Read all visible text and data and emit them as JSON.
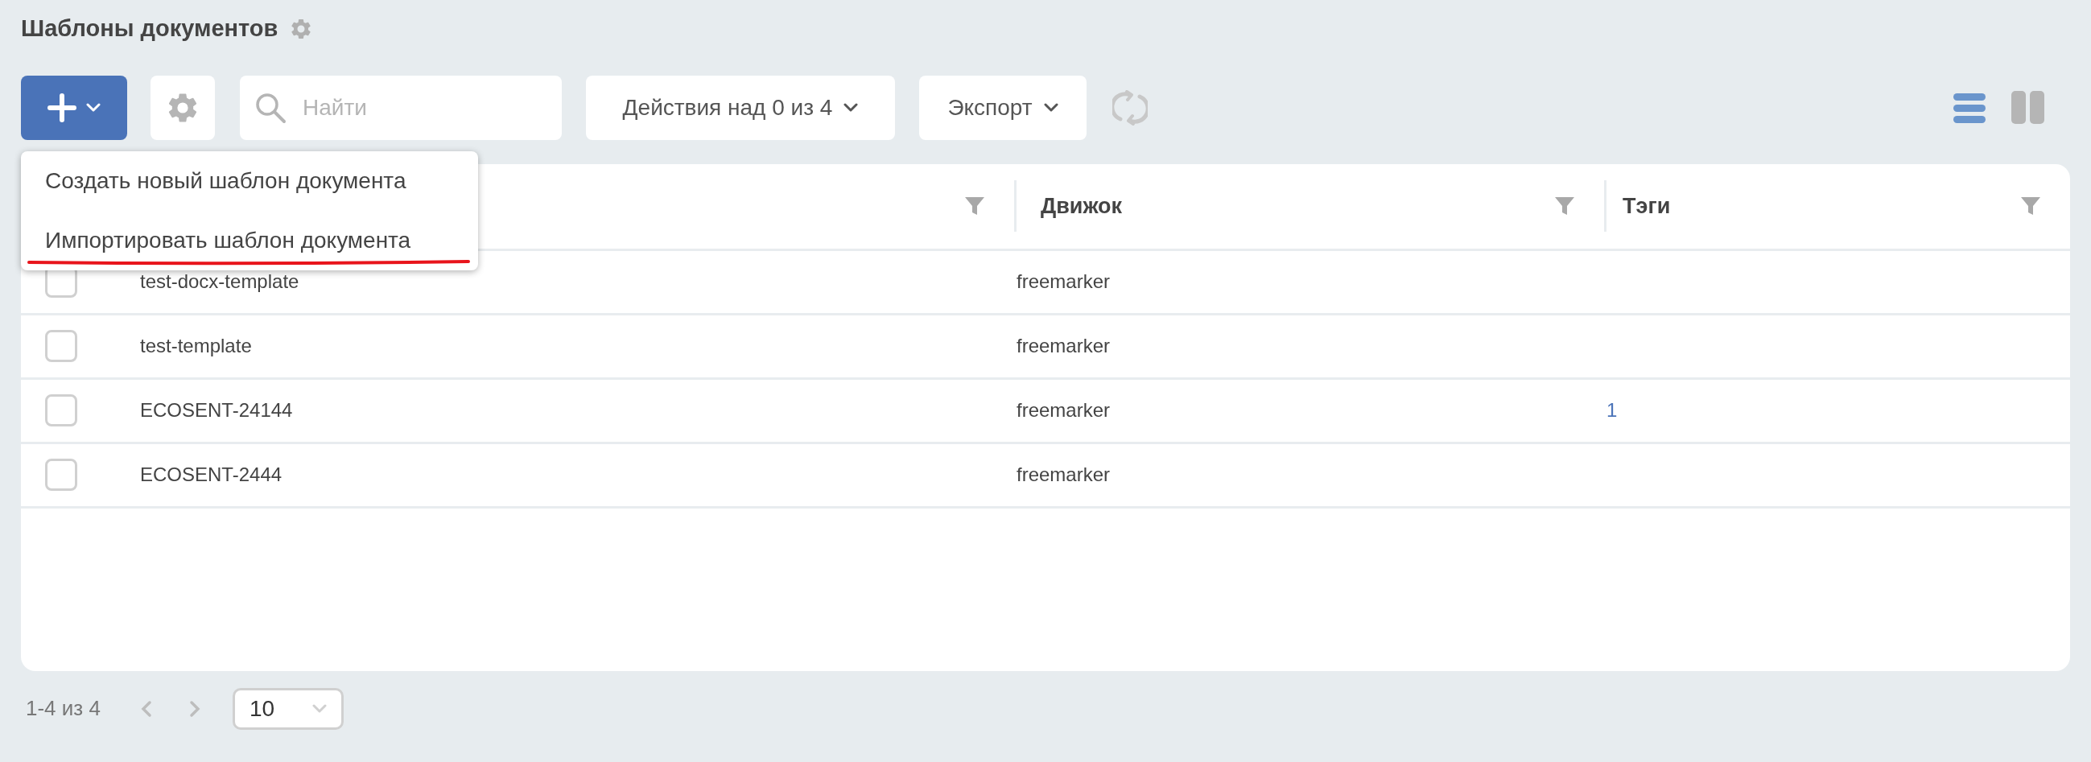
{
  "page": {
    "title": "Шаблоны документов"
  },
  "toolbar": {
    "search": {
      "placeholder": "Найти"
    },
    "actions_button": "Действия над 0 из 4",
    "export_button": "Экспорт",
    "view_modes": [
      {
        "kind": "list",
        "selected": true
      },
      {
        "kind": "columns",
        "selected": false
      }
    ]
  },
  "add_menu": {
    "expanded": true,
    "items": [
      {
        "label": "Создать новый шаблон документа",
        "underlined": false
      },
      {
        "label": "Импортировать шаблон документа",
        "underlined": true
      }
    ]
  },
  "table": {
    "columns": [
      {
        "label": "Движок"
      },
      {
        "label": "Тэги"
      }
    ],
    "rows": [
      {
        "selected": false,
        "name": "test-docx-template",
        "engine": "freemarker"
      },
      {
        "selected": false,
        "name": "test-template",
        "engine": "freemarker"
      },
      {
        "selected": false,
        "name": "ECOSENT-24144",
        "engine": "freemarker",
        "tags": "1"
      },
      {
        "selected": false,
        "name": "ECOSENT-2444",
        "engine": "freemarker"
      }
    ]
  },
  "pagination": {
    "range": "1-4 из 4",
    "page_size": "10"
  }
}
